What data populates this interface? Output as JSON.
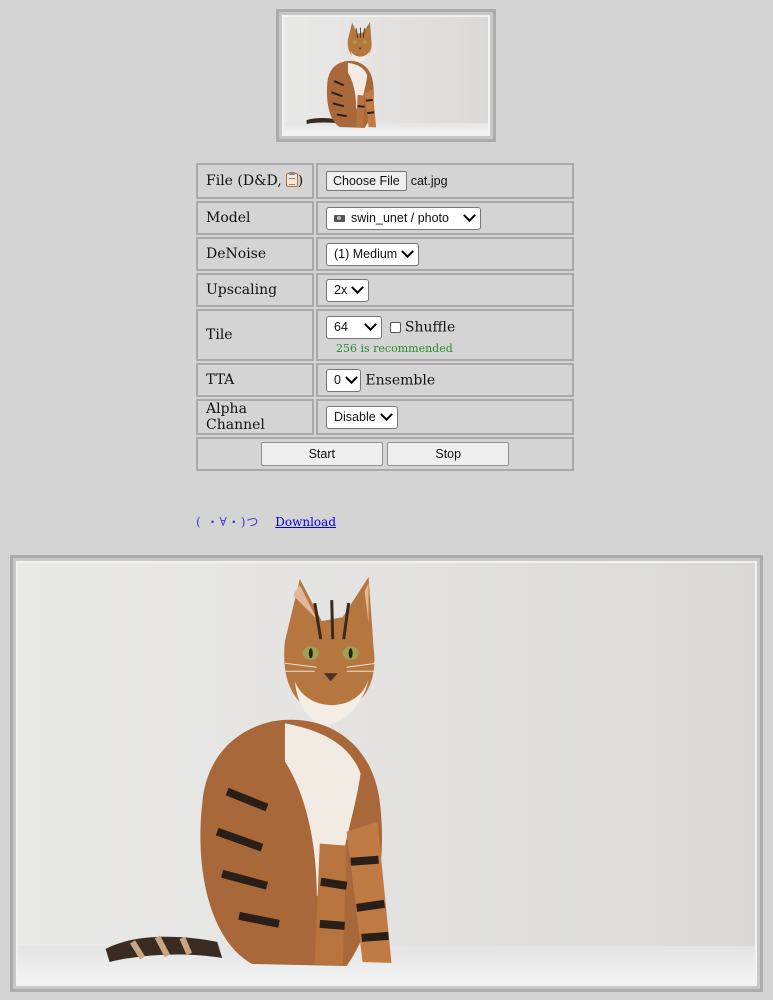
{
  "form": {
    "file": {
      "label_prefix": "File (D&D,",
      "label_suffix": ")",
      "icon": "clipboard-icon",
      "button": "Choose File",
      "filename": "cat.jpg"
    },
    "model": {
      "label": "Model",
      "selected": "swin_unet / photo",
      "icon": "camera-icon"
    },
    "denoise": {
      "label": "DeNoise",
      "selected": "(1) Medium"
    },
    "upscaling": {
      "label": "Upscaling",
      "selected": "2x"
    },
    "tile": {
      "label": "Tile",
      "selected": "64",
      "shuffle_label": "Shuffle",
      "shuffle_checked": false,
      "hint": "256 is recommended"
    },
    "tta": {
      "label": "TTA",
      "selected": "0",
      "ensemble_label": "Ensemble"
    },
    "alpha": {
      "label": "Alpha Channel",
      "selected": "Disable"
    },
    "buttons": {
      "start": "Start",
      "stop": "Stop"
    }
  },
  "output": {
    "kaomoji": "( ・∀・)つ",
    "download": "Download"
  },
  "colors": {
    "background": "#d4d4d4",
    "hint": "#2c8a2c",
    "link": "#0000ee"
  }
}
